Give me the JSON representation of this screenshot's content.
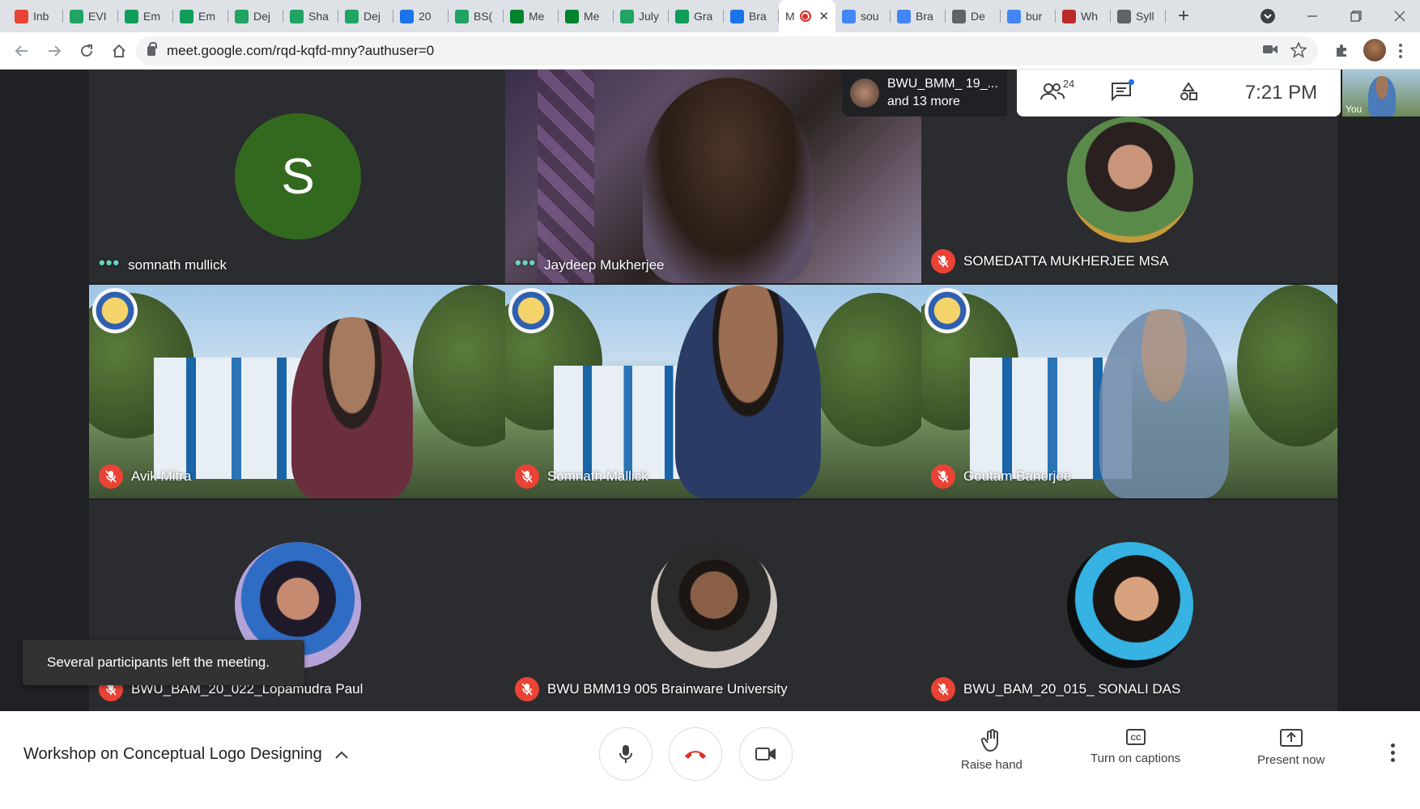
{
  "browser": {
    "tabs": [
      {
        "title": "Inb",
        "icon": "gmail-icon",
        "color": "#ea4335"
      },
      {
        "title": "EVI",
        "icon": "drive-icon",
        "color": "#1fa463"
      },
      {
        "title": "Em",
        "icon": "sheets-icon",
        "color": "#0f9d58"
      },
      {
        "title": "Em",
        "icon": "sheets-icon",
        "color": "#0f9d58"
      },
      {
        "title": "Dej",
        "icon": "drive-icon",
        "color": "#1fa463"
      },
      {
        "title": "Sha",
        "icon": "drive-icon",
        "color": "#1fa463"
      },
      {
        "title": "Dej",
        "icon": "drive-icon",
        "color": "#1fa463"
      },
      {
        "title": "20",
        "icon": "contacts-icon",
        "color": "#1a73e8"
      },
      {
        "title": "BS(",
        "icon": "drive-icon",
        "color": "#1fa463"
      },
      {
        "title": "Me",
        "icon": "meet-icon",
        "color": "#00832d"
      },
      {
        "title": "Me",
        "icon": "meet-icon",
        "color": "#00832d"
      },
      {
        "title": "July",
        "icon": "drive-icon",
        "color": "#1fa463"
      },
      {
        "title": "Gra",
        "icon": "sheets-icon",
        "color": "#0f9d58"
      },
      {
        "title": "Bra",
        "icon": "calendar-icon",
        "color": "#1a73e8"
      },
      {
        "title": "M",
        "icon": "recording-icon",
        "color": "#d93025",
        "active": true
      },
      {
        "title": "sou",
        "icon": "google-icon",
        "color": "#4285f4"
      },
      {
        "title": "Bra",
        "icon": "chrome-icon",
        "color": "#4285f4"
      },
      {
        "title": "De",
        "icon": "globe-icon",
        "color": "#5f6368"
      },
      {
        "title": "bur",
        "icon": "google-icon",
        "color": "#4285f4"
      },
      {
        "title": "Wh",
        "icon": "quora-icon",
        "color": "#b92b27"
      },
      {
        "title": "Syll",
        "icon": "globe-icon",
        "color": "#5f6368"
      }
    ],
    "new_tab": "+",
    "url": "meet.google.com/rqd-kqfd-mny?authuser=0"
  },
  "meet": {
    "tiles": [
      {
        "name": "somnath mullick",
        "avatar": "letter",
        "letter": "S",
        "status": "speaking-dots"
      },
      {
        "name": "Jaydeep Mukherjee",
        "avatar": "video",
        "status": "speaking-dots"
      },
      {
        "name": "SOMEDATTA MUKHERJEE MSA",
        "avatar": "photo",
        "status": "muted"
      },
      {
        "name": "Avik Mitra",
        "avatar": "video-campus",
        "status": "muted"
      },
      {
        "name": "Somnath Mallick",
        "avatar": "video-campus",
        "status": "muted"
      },
      {
        "name": "Goutam Banerjee",
        "avatar": "video-campus",
        "status": "muted"
      },
      {
        "name": "BWU_BAM_20_022_Lopamudra Paul",
        "avatar": "photo",
        "status": "muted"
      },
      {
        "name": "BWU BMM19 005 Brainware University",
        "avatar": "photo",
        "status": "muted"
      },
      {
        "name": "BWU_BAM_20_015_ SONALI DAS",
        "avatar": "photo",
        "status": "muted"
      }
    ],
    "presenter_chip": {
      "line1": "BWU_BMM_ 19_...",
      "line2": "and 13 more"
    },
    "participant_count": "24",
    "clock": "7:21 PM",
    "self_label": "You",
    "toast": "Several participants left the meeting."
  },
  "bottom_bar": {
    "meeting_title": "Workshop on Conceptual Logo Designing",
    "raise_hand": "Raise hand",
    "captions": "Turn on captions",
    "present": "Present now"
  },
  "colors": {
    "mute_red": "#ea4335",
    "speaking_teal": "#6ad2c5",
    "meet_bg": "#202124",
    "letter_avatar": "#33691e"
  }
}
